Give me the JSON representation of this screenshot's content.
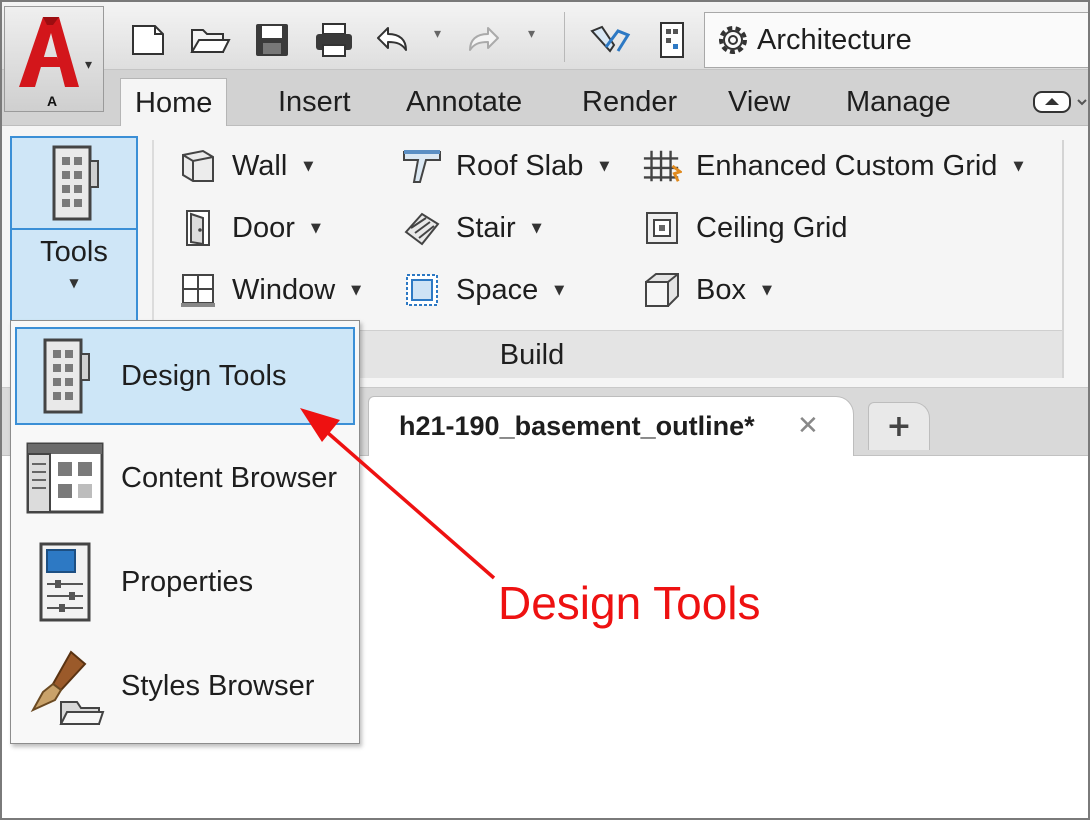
{
  "app": {
    "letter": "A",
    "logo_color": "#d3161b"
  },
  "quick_access": {
    "icons": [
      "new-icon",
      "open-icon",
      "save-icon",
      "print-icon",
      "undo-icon",
      "redo-icon",
      "wire-icon",
      "project-icon"
    ],
    "workspace": {
      "label": "Architecture",
      "icon": "gear-icon"
    }
  },
  "ribbon_tabs": [
    {
      "label": "Home",
      "active": true
    },
    {
      "label": "Insert",
      "active": false
    },
    {
      "label": "Annotate",
      "active": false
    },
    {
      "label": "Render",
      "active": false
    },
    {
      "label": "View",
      "active": false
    },
    {
      "label": "Manage",
      "active": false
    }
  ],
  "ribbon": {
    "tools_button": {
      "label": "Tools",
      "active_color": "#cfe6f7"
    },
    "build_panel": {
      "title": "Build",
      "items": [
        {
          "label": "Wall",
          "icon": "wall-icon",
          "dropdown": true
        },
        {
          "label": "Door",
          "icon": "door-icon",
          "dropdown": true
        },
        {
          "label": "Window",
          "icon": "window-icon",
          "dropdown": true
        },
        {
          "label": "Roof Slab",
          "icon": "roof-slab-icon",
          "dropdown": true
        },
        {
          "label": "Stair",
          "icon": "stair-icon",
          "dropdown": true
        },
        {
          "label": "Space",
          "icon": "space-icon",
          "dropdown": true
        },
        {
          "label": "Enhanced Custom Grid",
          "icon": "custom-grid-icon",
          "dropdown": true
        },
        {
          "label": "Ceiling Grid",
          "icon": "ceiling-grid-icon",
          "dropdown": false
        },
        {
          "label": "Box",
          "icon": "box-icon",
          "dropdown": true
        }
      ]
    }
  },
  "file_tabs": {
    "active": {
      "label": "h21-190_basement_outline*",
      "close": "✕"
    },
    "new_tab": "+"
  },
  "tools_menu": {
    "items": [
      {
        "label": "Design Tools",
        "icon": "design-tools-icon",
        "selected": true
      },
      {
        "label": "Content Browser",
        "icon": "content-browser-icon",
        "selected": false
      },
      {
        "label": "Properties",
        "icon": "properties-icon",
        "selected": false
      },
      {
        "label": "Styles Browser",
        "icon": "styles-browser-icon",
        "selected": false
      }
    ]
  },
  "annotation": {
    "text": "Design Tools",
    "color": "#ee1111"
  }
}
